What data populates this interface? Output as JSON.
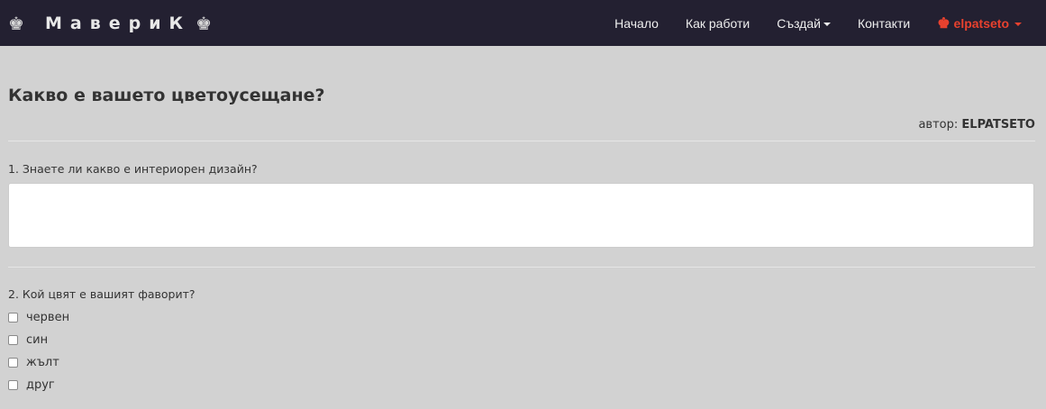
{
  "navbar": {
    "brand": "МавериК",
    "brand_icon_left": "chess-king-icon",
    "brand_icon_right": "chess-king-icon",
    "items": [
      {
        "label": "Начало"
      },
      {
        "label": "Как работи"
      },
      {
        "label": "Създай",
        "dropdown": true
      },
      {
        "label": "Контакти"
      }
    ],
    "user": {
      "label": "elpatseto",
      "icon": "chess-king-icon",
      "color": "#e8412e"
    }
  },
  "survey": {
    "title": "Какво е вашето цветоусещане?",
    "author_prefix": "автор:",
    "author_name": "ELPATSETO",
    "questions": [
      {
        "label": "1. Знаете ли какво е интериорен дизайн?",
        "type": "text",
        "value": ""
      },
      {
        "label": "2. Кой цвят е вашият фаворит?",
        "type": "checkbox",
        "options": [
          "червен",
          "син",
          "жълт",
          "друг"
        ]
      }
    ]
  },
  "colors": {
    "navbar_bg": "#232031",
    "page_bg": "#d2d2d2",
    "accent": "#e8412e"
  }
}
